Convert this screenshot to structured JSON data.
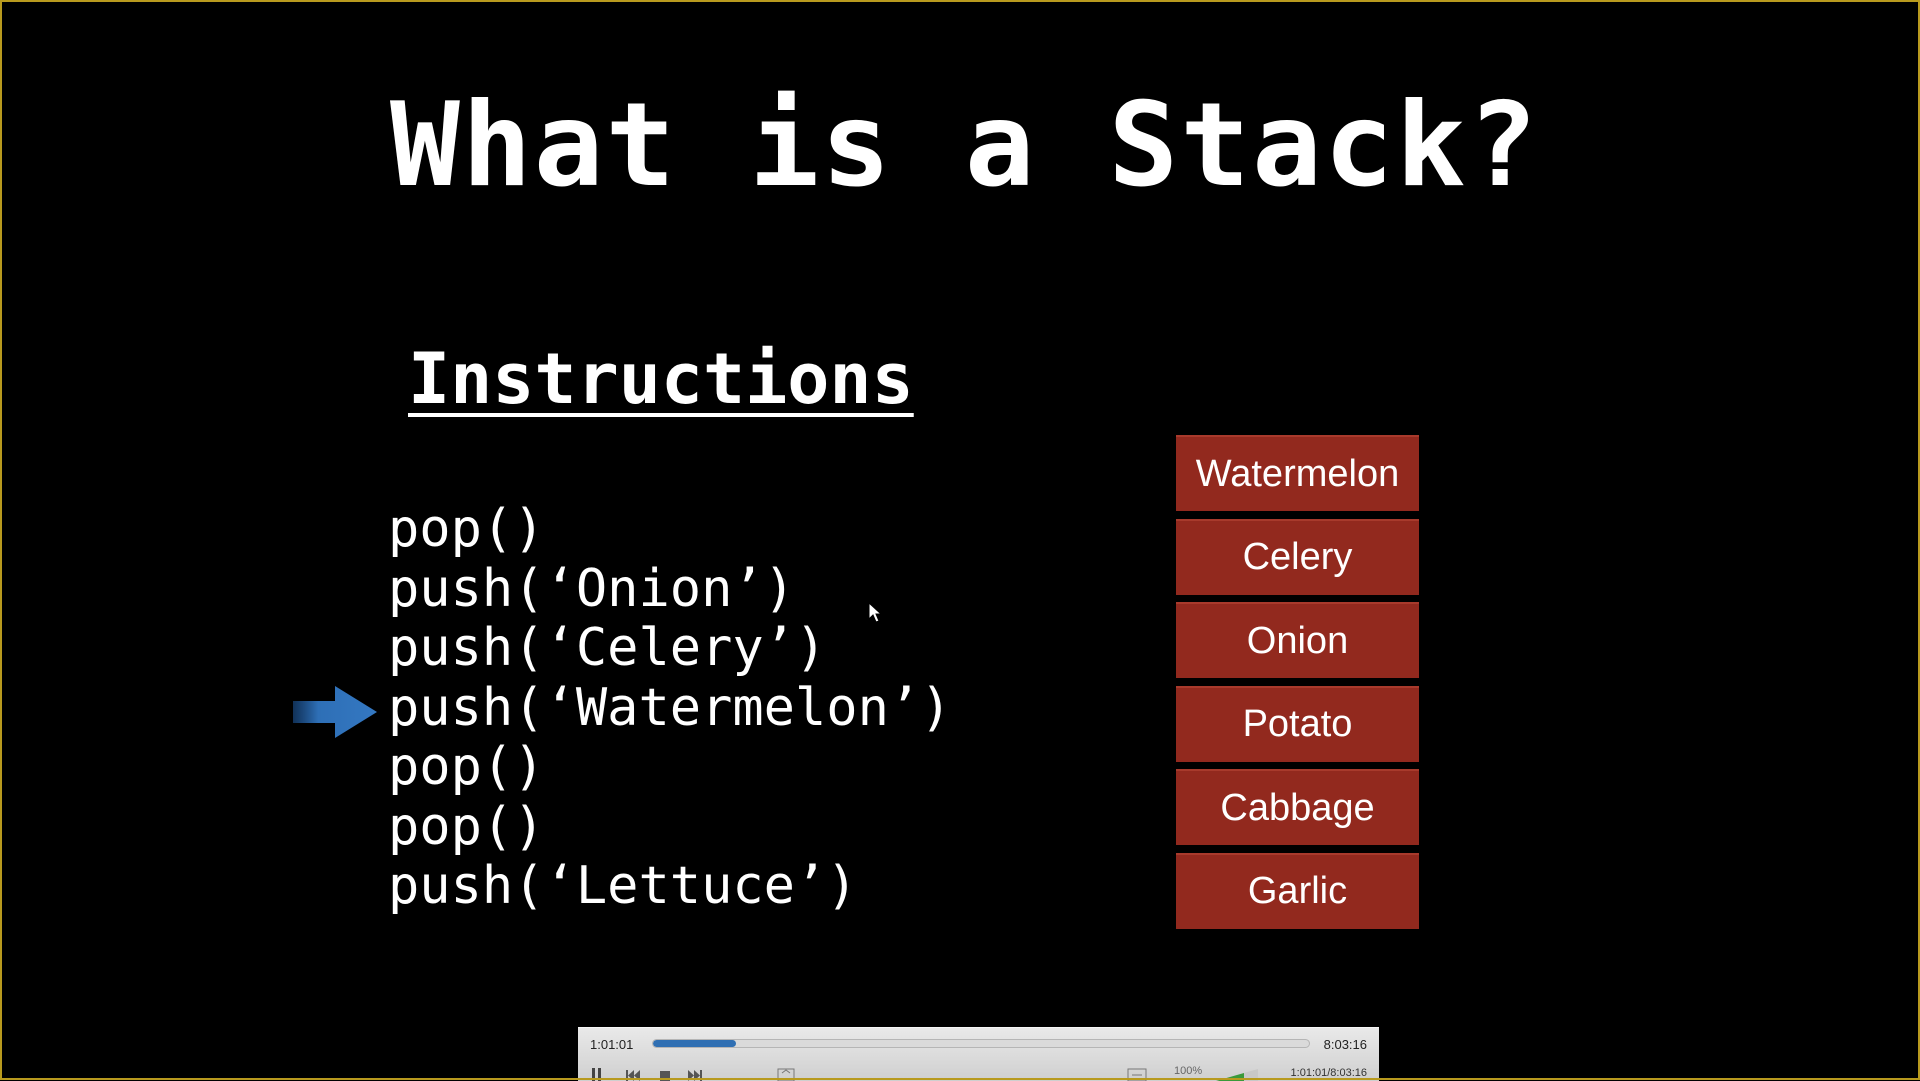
{
  "slide": {
    "title": "What is a Stack?",
    "heading": "Instructions",
    "instructions": [
      "pop()",
      "push(‘Onion’)",
      "push(‘Celery’)",
      "push(‘Watermelon’)",
      "pop()",
      "pop()",
      "push(‘Lettuce’)"
    ],
    "current_instruction_index": 3,
    "stack": [
      "Watermelon",
      "Celery",
      "Onion",
      "Potato",
      "Cabbage",
      "Garlic"
    ]
  },
  "player": {
    "current_time": "1:01:01",
    "total_time": "8:03:16",
    "progress": 0.126,
    "volume_label": "100%",
    "time_small": "1:01:01/8:03:16"
  },
  "icons": {
    "arrow": "right-arrow-icon",
    "cursor": "mouse-cursor-icon",
    "pause": "pause-icon",
    "prev": "skip-back-icon",
    "stop": "stop-icon",
    "next": "skip-forward-icon",
    "fullscreen": "fullscreen-icon",
    "aspect": "aspect-icon"
  },
  "colors": {
    "background": "#000000",
    "stack_box": "#92291e",
    "arrow": "#2f6fb3",
    "frame": "#b89a1e",
    "progress": "#2f6fb3"
  }
}
